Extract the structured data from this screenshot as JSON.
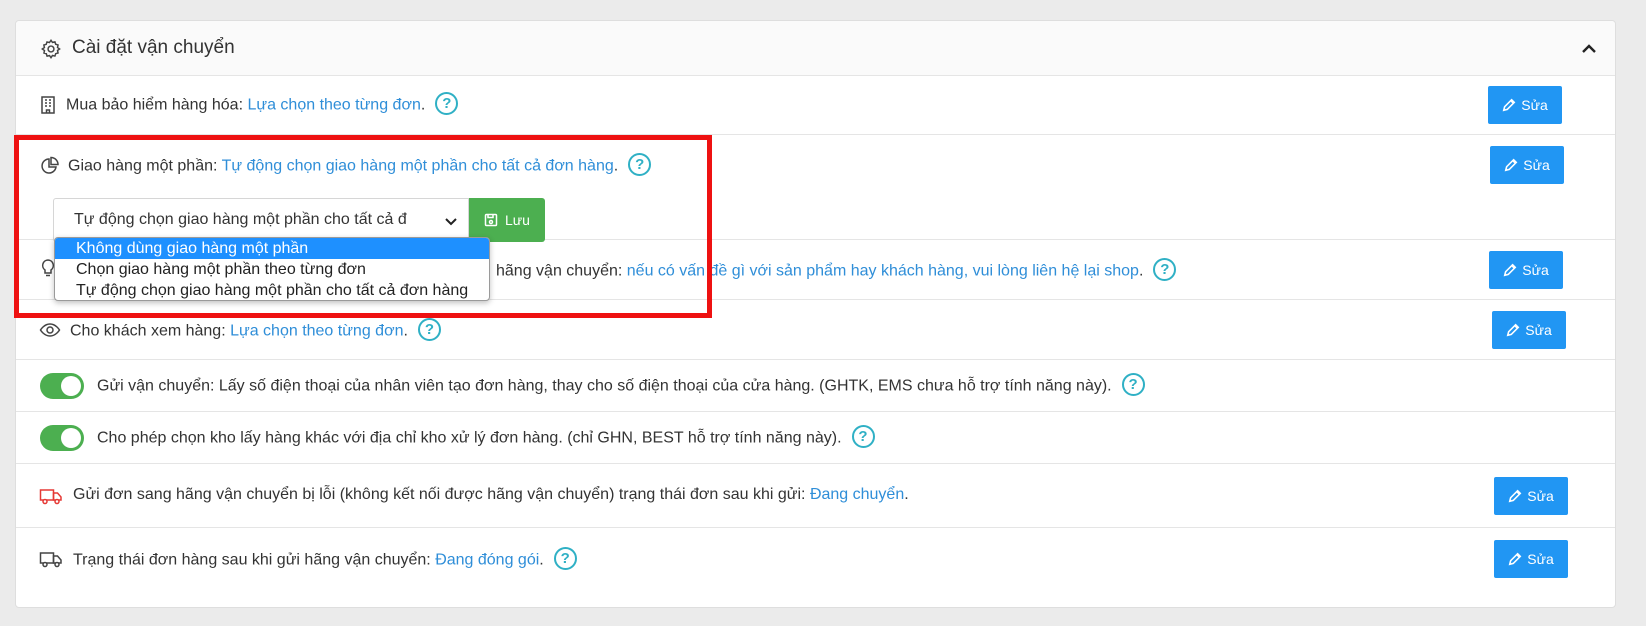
{
  "panel": {
    "title": "Cài đặt vận chuyển",
    "gear_icon": "gear-icon",
    "collapse_icon": "chevron-up-icon"
  },
  "rows": {
    "insurance": {
      "label": "Mua bảo hiểm hàng hóa: ",
      "value": "Lựa chọn theo từng đơn",
      "suffix": ".",
      "help": "?",
      "button": "Sửa"
    },
    "partial": {
      "label": "Giao hàng một phần: ",
      "value": "Tự động chọn giao hàng một phần cho tất cả đơn hàng",
      "suffix": ".",
      "help": "?",
      "button": "Sửa",
      "select_value": "Tự động chọn giao hàng một phần cho tất cả đ",
      "save_label": "Lưu",
      "options": [
        "Không dùng giao hàng một phần",
        "Chọn giao hàng một phần theo từng đơn",
        "Tự động chọn giao hàng một phần cho tất cả đơn hàng"
      ]
    },
    "note": {
      "label": "hãng vận chuyển: ",
      "value": "nếu có vấn đề gì với sản phẩm hay khách hàng, vui lòng liên hệ lại shop",
      "suffix": ".",
      "help": "?",
      "button": "Sửa"
    },
    "view": {
      "label": "Cho khách xem hàng: ",
      "value": "Lựa chọn theo từng đơn",
      "suffix": ".",
      "help": "?",
      "button": "Sửa"
    },
    "send_phone": {
      "label": "Gửi vận chuyển: Lấy số điện thoại của nhân viên tạo đơn hàng, thay cho số điện thoại của cửa hàng. (GHTK, EMS chưa hỗ trợ tính năng này).",
      "help": "?"
    },
    "warehouse": {
      "label": "Cho phép chọn kho lấy hàng khác với địa chỉ kho xử lý đơn hàng. (chỉ GHN, BEST hỗ trợ tính năng này).",
      "help": "?"
    },
    "error_status": {
      "label": "Gửi đơn sang hãng vận chuyển bị lỗi (không kết nối được hãng vận chuyển) trạng thái đơn sau khi gửi: ",
      "value": "Đang chuyển",
      "suffix": ".",
      "button": "Sửa"
    },
    "after_status": {
      "label": "Trạng thái đơn hàng sau khi gửi hãng vận chuyển: ",
      "value": "Đang đóng gói",
      "suffix": ".",
      "help": "?",
      "button": "Sửa"
    }
  },
  "colors": {
    "accent": "#2196f3",
    "link": "#2f8ed8",
    "help": "#2fb0c5",
    "success": "#4caf50",
    "highlight": "#ee1111",
    "truck_error": "#e53935"
  }
}
